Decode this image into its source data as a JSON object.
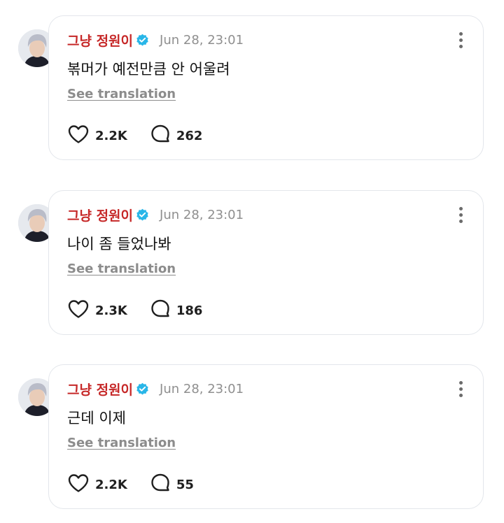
{
  "posts": [
    {
      "username": "그냥 정원이",
      "timestamp": "Jun 28, 23:01",
      "text": "볶머가 예전만큼 안 어울려",
      "see_translation": "See translation",
      "likes": "2.2K",
      "replies": "262"
    },
    {
      "username": "그냥 정원이",
      "timestamp": "Jun 28, 23:01",
      "text": "나이 좀 들었나봐",
      "see_translation": "See translation",
      "likes": "2.3K",
      "replies": "186"
    },
    {
      "username": "그냥 정원이",
      "timestamp": "Jun 28, 23:01",
      "text": "근데 이제",
      "see_translation": "See translation",
      "likes": "2.2K",
      "replies": "55"
    }
  ],
  "icons": {
    "verified": "verified-badge-icon",
    "more": "more-options-icon",
    "like": "heart-icon",
    "reply": "comment-bubble-icon"
  },
  "colors": {
    "username": "#c62828",
    "verified_badge": "#29b6e8",
    "timestamp": "#8f8f8f",
    "card_border": "#e3e6eb"
  }
}
